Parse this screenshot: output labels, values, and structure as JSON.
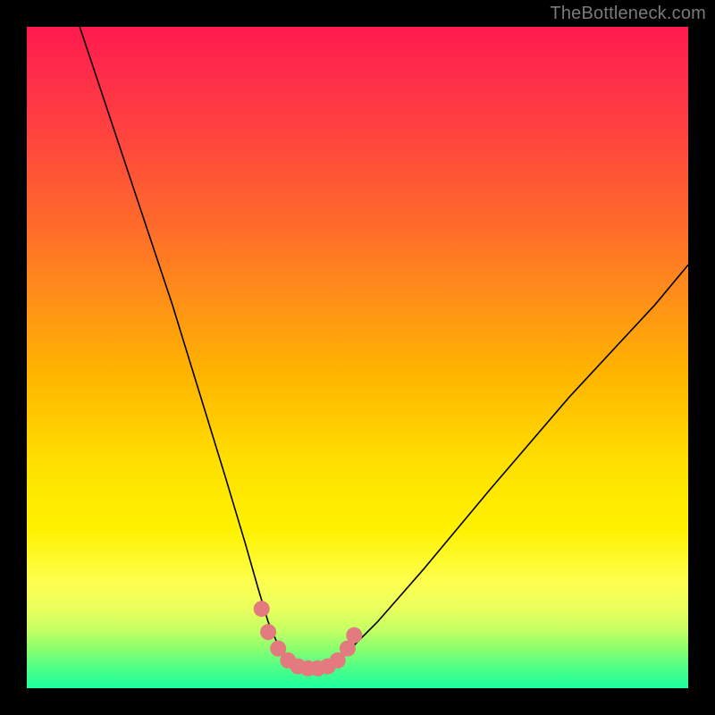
{
  "watermark": "TheBottleneck.com",
  "colors": {
    "marker": "#e27a7f",
    "curve": "#000000",
    "frame_bg": "#000000"
  },
  "chart_data": {
    "type": "line",
    "title": "",
    "xlabel": "",
    "ylabel": "",
    "xlim": [
      0,
      100
    ],
    "ylim": [
      0,
      100
    ],
    "grid": false,
    "legend": false,
    "series": [
      {
        "name": "bottleneck-curve",
        "x": [
          8,
          10,
          12,
          15,
          18,
          22,
          26,
          30,
          33,
          35,
          36.5,
          38,
          40,
          42,
          44,
          46,
          48,
          53,
          60,
          70,
          82,
          95,
          100
        ],
        "y": [
          100,
          94,
          88,
          79,
          70,
          58,
          45,
          32,
          22,
          15,
          10,
          6.5,
          4,
          3,
          3,
          3.5,
          5,
          10,
          18,
          30,
          44,
          58,
          64
        ]
      }
    ],
    "markers": {
      "name": "highlighted-points",
      "x": [
        35.5,
        36.5,
        38,
        39.5,
        41,
        42.5,
        44,
        45.5,
        47,
        48.5,
        49.5
      ],
      "y": [
        12,
        8.5,
        6,
        4.2,
        3.3,
        3,
        3,
        3.3,
        4.2,
        6,
        8
      ]
    }
  }
}
